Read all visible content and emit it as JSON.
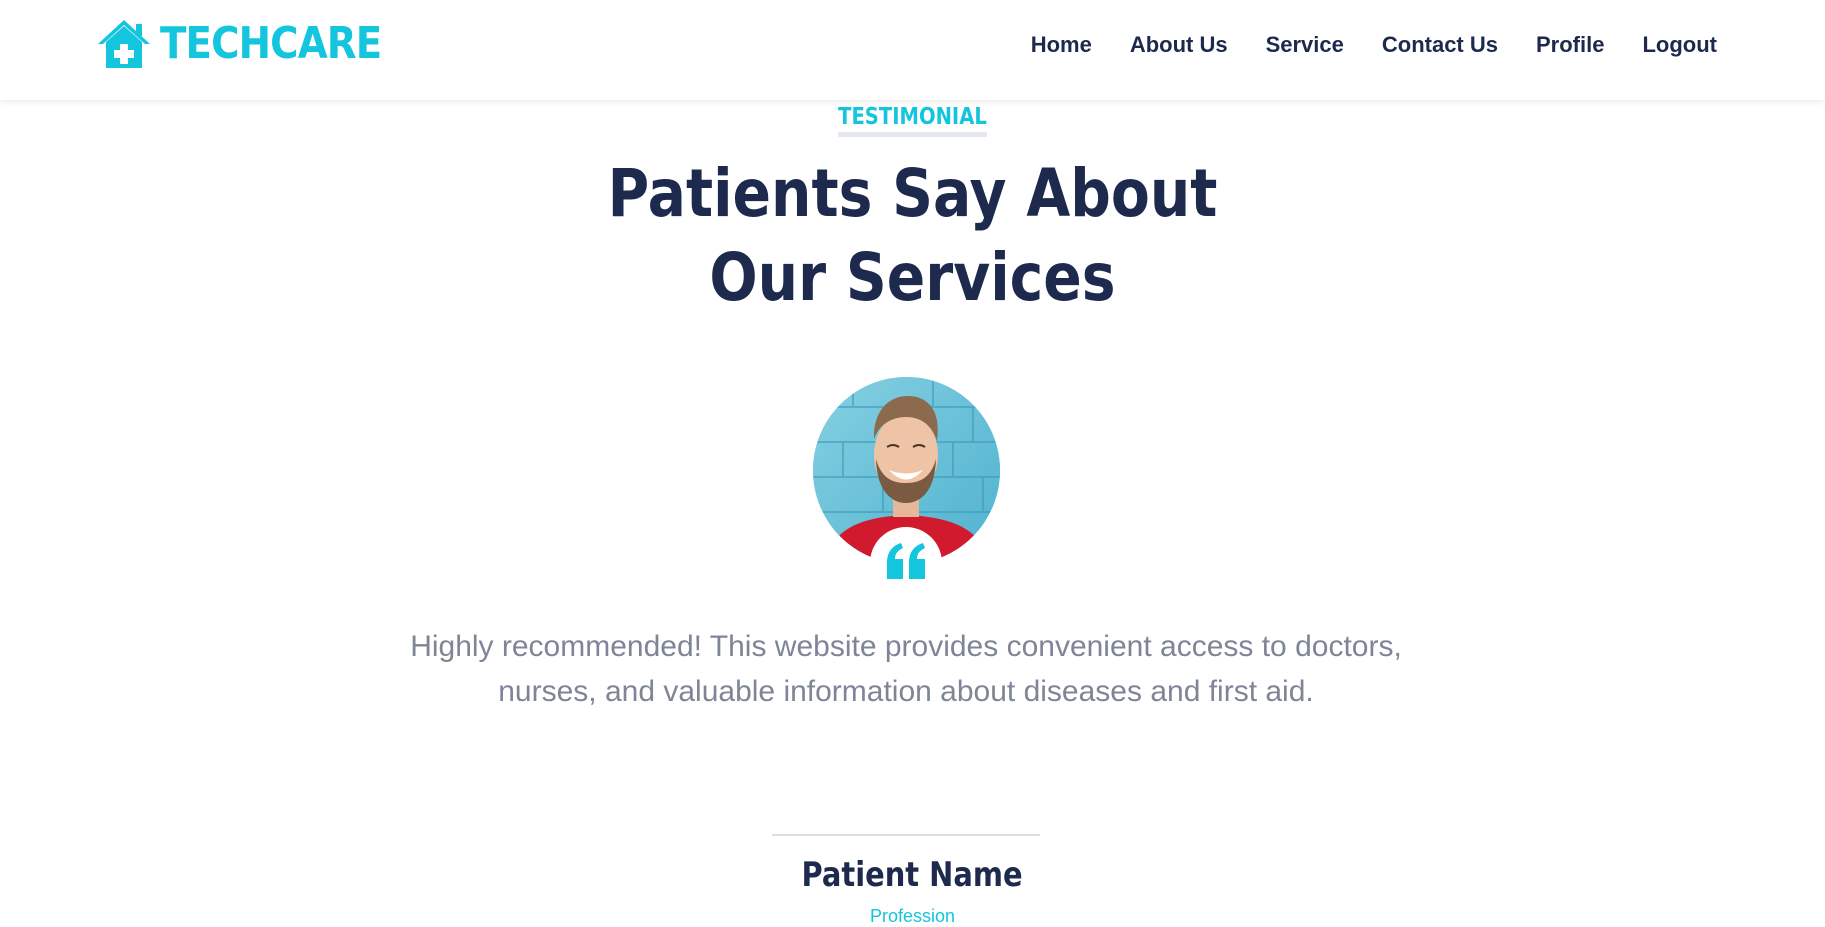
{
  "brand": {
    "name": "TECHCARE",
    "icon": "house-medical-icon",
    "color": "#13C5DD"
  },
  "nav": {
    "items": [
      {
        "label": "Home"
      },
      {
        "label": "About Us"
      },
      {
        "label": "Service"
      },
      {
        "label": "Contact Us"
      },
      {
        "label": "Profile"
      },
      {
        "label": "Logout"
      }
    ]
  },
  "testimonial": {
    "eyebrow": "TESTIMONIAL",
    "heading_line1": "Patients Say About",
    "heading_line2": "Our Services",
    "quote_icon": "quote-left-icon",
    "text": "Highly recommended! This website provides convenient access to doctors, nurses, and valuable information about diseases and first aid.",
    "patient_name": "Patient Name",
    "profession": "Profession"
  },
  "colors": {
    "accent": "#13C5DD",
    "heading": "#1D2A4D",
    "body_text": "#7D8597"
  }
}
